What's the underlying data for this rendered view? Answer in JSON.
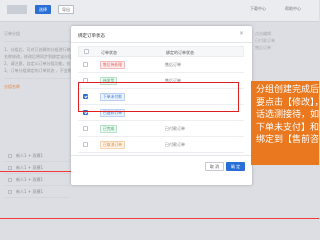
{
  "modal": {
    "title": "绑定订单状态",
    "close_glyph": "×",
    "columns": {
      "status": "订单状态",
      "scope": "绑定的订单状态"
    },
    "rows": [
      {
        "label": "售后待处理",
        "color": "red",
        "checked": false,
        "scope": "售后订单"
      },
      {
        "label": "待发货",
        "color": "green",
        "checked": false,
        "scope": "售后订单"
      },
      {
        "label": "下单未付款",
        "color": "blue",
        "checked": true,
        "scope": ""
      },
      {
        "label": "已退款订单",
        "color": "blue",
        "checked": true,
        "scope": ""
      },
      {
        "label": "已完成",
        "color": "green",
        "checked": false,
        "scope": "已付款订单"
      },
      {
        "label": "已取消订单",
        "color": "orange",
        "checked": false,
        "scope": "已付款订单"
      },
      {
        "label": "交易已关闭",
        "color": "pink",
        "checked": false,
        "scope": "已付款订单"
      }
    ],
    "cancel_label": "取 消",
    "ok_label": "确 定"
  },
  "background": {
    "top_buttons": [
      "选择",
      "导出"
    ],
    "top_right": [
      "下载中心",
      "帮助中心"
    ],
    "left_texts": [
      "订单分组",
      "1、分组后，可对已创建的分组进行修改或删除操作，可对分组",
      "名称修改，修改后将同步到绑定该分组的订单",
      "2、请注意，自定义订单分组功能，仅可通过此处设置",
      "3、订单分组绑定的订单状态 ，不会影响分组下的订单"
    ],
    "left_orange": "分组名称",
    "rows": [
      "新人1 + 双模1",
      "新人1 + 双模1",
      "新人1 + 双模1",
      "新人1 + 双模1"
    ],
    "right_texts": [
      "点击编辑",
      "已付款订单",
      "售后订单"
    ]
  },
  "callout": {
    "lines": [
      "分组创建完成后",
      "要点击【修改】，",
      "话选测接待，如",
      "下单未支付】和",
      "绑定到【售前咨"
    ]
  },
  "colors": {
    "callout_bg": "#e9781f",
    "highlight": "#e02020",
    "primary": "#2a6fd6"
  }
}
